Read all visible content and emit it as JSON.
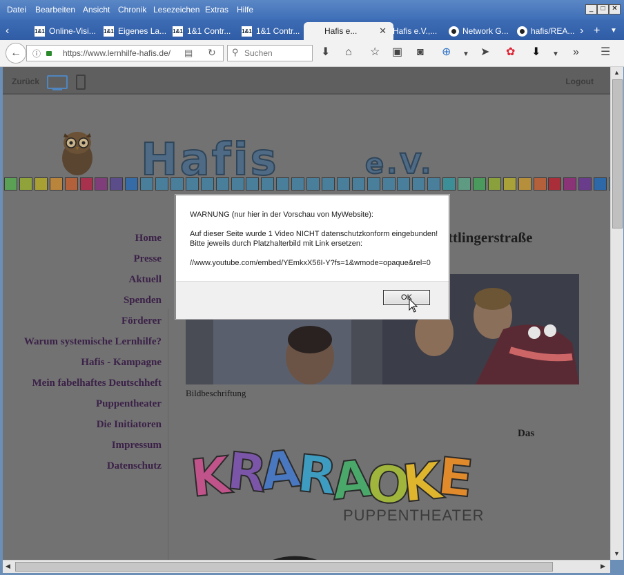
{
  "menubar": {
    "items": [
      {
        "label": "Datei"
      },
      {
        "label": "Bearbeiten"
      },
      {
        "label": "Ansicht"
      },
      {
        "label": "Chronik"
      },
      {
        "label": "Lesezeichen"
      },
      {
        "label": "Extras"
      },
      {
        "label": "Hilfe"
      }
    ]
  },
  "window_buttons": {
    "minimize": "_",
    "maximize": "□",
    "close": "✕"
  },
  "tabs": [
    {
      "label": "Online-Visi...",
      "icon": "1&1"
    },
    {
      "label": "Eigenes La...",
      "icon": "1&1"
    },
    {
      "label": "1&1 Contr...",
      "icon": "1&1"
    },
    {
      "label": "1&1 Contr...",
      "icon": "1&1"
    },
    {
      "label": "Hafis e...",
      "active": true
    },
    {
      "label": "Hafis e.V.,..."
    },
    {
      "label": "Network G...",
      "icon": "github-icon"
    },
    {
      "label": "hafis/REA...",
      "icon": "github-icon"
    }
  ],
  "navbar": {
    "url": "https://www.lernhilfe-hafis.de/",
    "search_placeholder": "Suchen"
  },
  "editor": {
    "back_label": "Zurück",
    "logout_label": "Logout"
  },
  "site": {
    "logo_main": "Hafis",
    "logo_suffix": "e.V.",
    "square_colors": [
      "#5aa055",
      "#8fa33a",
      "#a8a032",
      "#b9843b",
      "#b2613a",
      "#a8324d",
      "#7f3d7a",
      "#5b4d8a",
      "#356ca8",
      "#4a7f9c",
      "#4a7f9c",
      "#4a7f9c",
      "#4a7f9c",
      "#4a7f9c",
      "#4a7f9c",
      "#4a7f9c",
      "#4a7f9c",
      "#4a7f9c",
      "#4a7f9c",
      "#4a7f9c",
      "#4a7f9c",
      "#4a7f9c",
      "#4a7f9c",
      "#4a7f9c",
      "#4a7f9c",
      "#4a7f9c",
      "#4a7f9c",
      "#4a7f9c",
      "#4a7f9c",
      "#3c8e97",
      "#5f9a83",
      "#4a9a5e",
      "#8aa03d",
      "#a9a238",
      "#b68f3c",
      "#b4603a",
      "#aa2e3a",
      "#8b3377",
      "#6a3c8c",
      "#2d68a8",
      "#4a7f9c"
    ],
    "nav": [
      {
        "label": "Home"
      },
      {
        "label": "Presse"
      },
      {
        "label": "Aktuell"
      },
      {
        "label": "Spenden"
      },
      {
        "label": "Förderer"
      },
      {
        "label": "Warum systemische Lernhilfe?"
      },
      {
        "label": "Hafis - Kampagne"
      },
      {
        "label": "Mein fabelhaftes Deutschheft"
      },
      {
        "label": "Puppentheater"
      },
      {
        "label": "Die Initiatoren"
      },
      {
        "label": "Impressum"
      },
      {
        "label": "Datenschutz"
      }
    ],
    "heading": "ttlingerstraße",
    "caption": "Bildbeschriftung",
    "das": "Das",
    "kraraoke_title": "KRARAOKE",
    "kraraoke_colors": [
      "#c0548a",
      "#7b56a8",
      "#4a78c0",
      "#3f9cc1",
      "#4aa86a",
      "#a0b53c",
      "#e0b52e",
      "#e08a2c",
      "#c9403a"
    ],
    "kraraoke_subtitle": "PUPPENTHEATER"
  },
  "dialog": {
    "line1": "WARNUNG (nur hier in der Vorschau von MyWebsite):",
    "line2": "Auf dieser Seite wurde 1 Video NICHT datenschutzkonform eingebunden!",
    "line3": "Bitte jeweils durch Platzhalterbild mit Link ersetzen:",
    "line4": "//www.youtube.com/embed/YEmkxX56I-Y?fs=1&wmode=opaque&rel=0",
    "ok_label": "OK"
  }
}
